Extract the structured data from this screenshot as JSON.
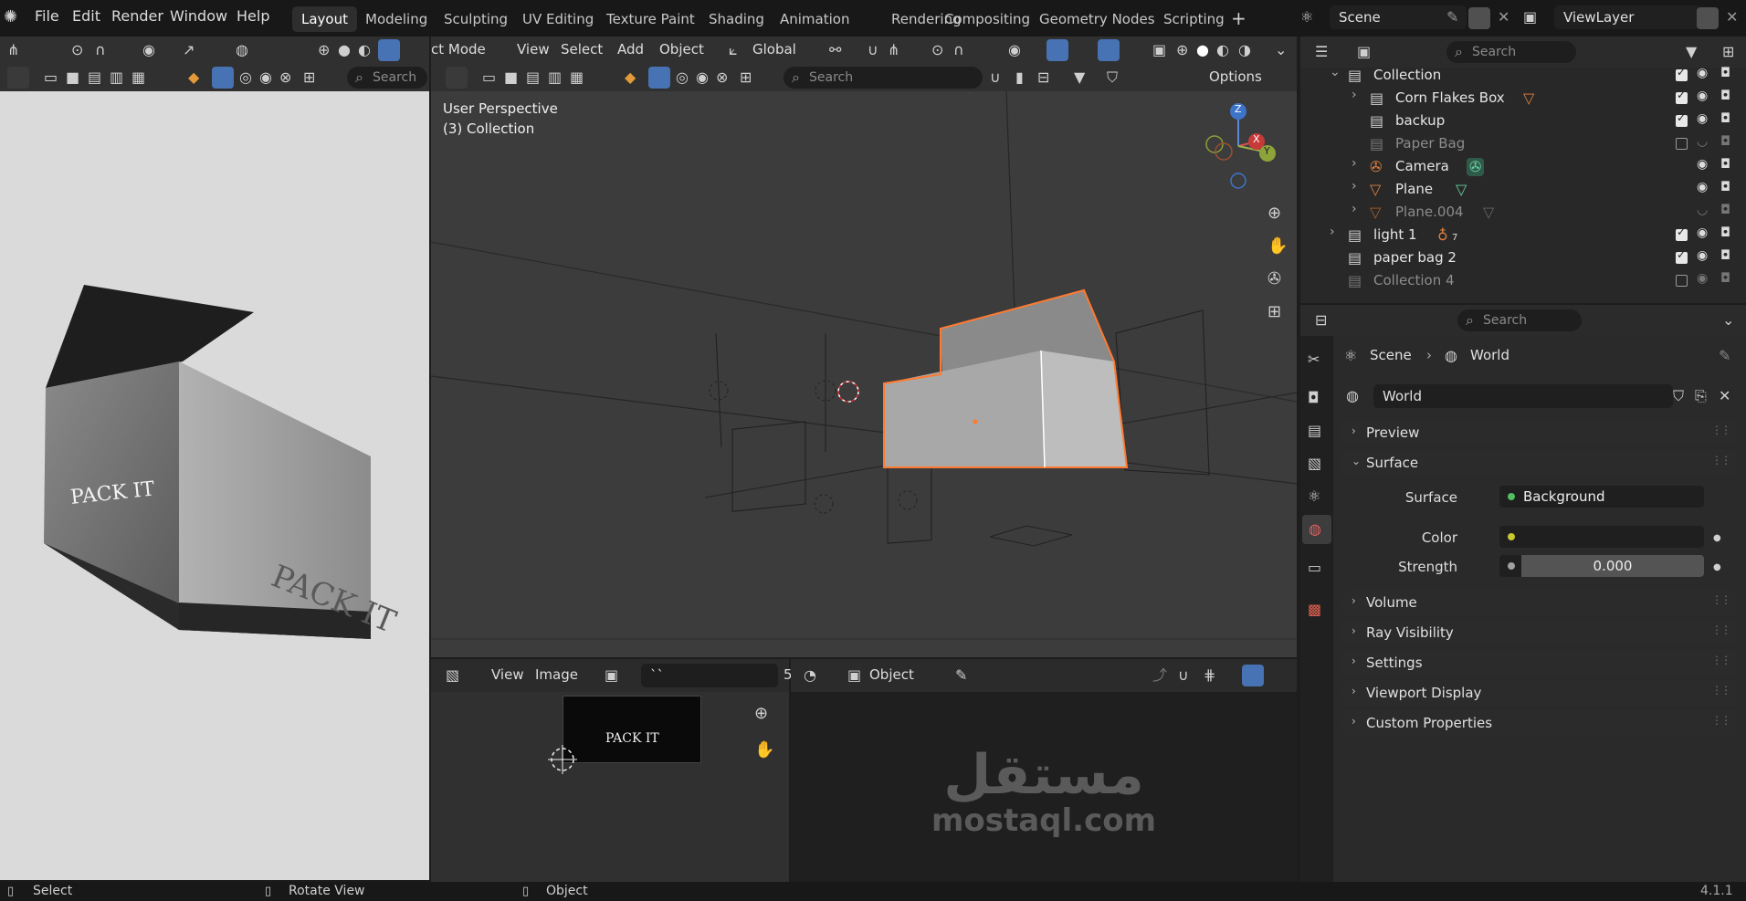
{
  "menu": {
    "file": "File",
    "edit": "Edit",
    "render": "Render",
    "window": "Window",
    "help": "Help"
  },
  "workspaces": [
    "Layout",
    "Modeling",
    "Sculpting",
    "UV Editing",
    "Texture Paint",
    "Shading",
    "Animation",
    "Rendering",
    "Compositing",
    "Geometry Nodes",
    "Scripting"
  ],
  "scene": {
    "label": "Scene",
    "viewlayer": "ViewLayer"
  },
  "left_header": {
    "search_placeholder": "Search"
  },
  "viewport": {
    "mode": "ct Mode",
    "menus": [
      "View",
      "Select",
      "Add",
      "Object"
    ],
    "orientation": "Global",
    "search_placeholder": "Search",
    "options": "Options",
    "perspective": "User Perspective",
    "collection": "(3) Collection",
    "axis_x": "X",
    "axis_y": "Y",
    "axis_z": "Z"
  },
  "render_image": {
    "text_front": "PACK IT",
    "text_side": "PACK IT"
  },
  "image_editor": {
    "view": "View",
    "image": "Image",
    "image_name": "``",
    "thumb_text": "PACK IT",
    "frame": "5"
  },
  "properties_header": {
    "object": "Object"
  },
  "outliner": {
    "search_placeholder": "Search",
    "rows": [
      {
        "name": "Collection"
      },
      {
        "name": "Corn Flakes Box"
      },
      {
        "name": "backup"
      },
      {
        "name": "Paper Bag"
      },
      {
        "name": "Camera"
      },
      {
        "name": "Plane"
      },
      {
        "name": "Plane.004"
      },
      {
        "name": "light 1",
        "badge": "7"
      },
      {
        "name": "paper bag 2"
      },
      {
        "name": "Collection 4"
      }
    ]
  },
  "properties": {
    "search_placeholder": "Search",
    "breadcrumb_scene": "Scene",
    "breadcrumb_world": "World",
    "world_name": "World",
    "panels": {
      "preview": "Preview",
      "surface": "Surface",
      "volume": "Volume",
      "ray_visibility": "Ray Visibility",
      "settings": "Settings",
      "viewport_display": "Viewport Display",
      "custom_properties": "Custom Properties"
    },
    "surface_label": "Surface",
    "surface_value": "Background",
    "color_label": "Color",
    "strength_label": "Strength",
    "strength_value": "0.000"
  },
  "watermark": {
    "arabic": "مستقل",
    "latin": "mostaql.com"
  },
  "status": {
    "select": "Select",
    "rotate": "Rotate View",
    "object": "Object",
    "version": "4.1.1"
  },
  "colors": {
    "accent": "#4772b3",
    "selection": "#ff7a30",
    "bg": "#1d1d1d"
  }
}
